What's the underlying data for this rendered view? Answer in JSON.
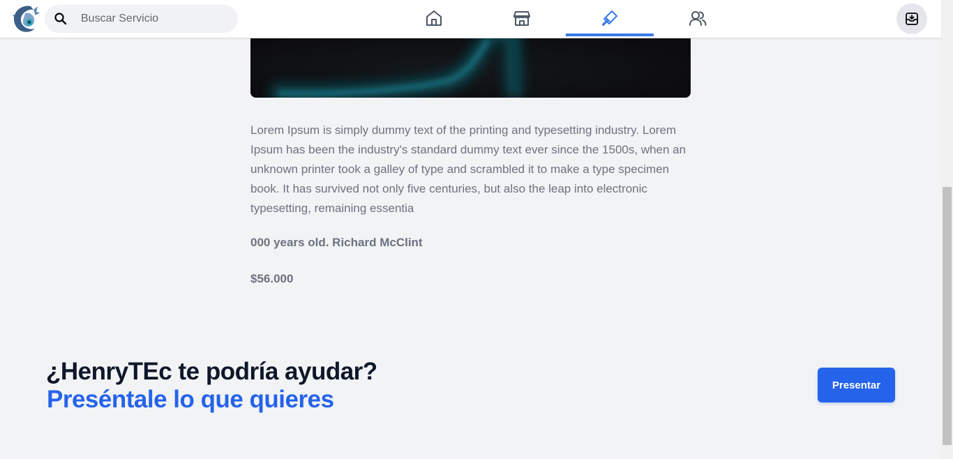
{
  "navbar": {
    "logo_icon": "dragon-logo-icon",
    "search": {
      "icon": "search-icon",
      "placeholder": "Buscar Servicio",
      "value": ""
    },
    "tabs": [
      {
        "icon": "home-icon",
        "active": false
      },
      {
        "icon": "store-icon",
        "active": false
      },
      {
        "icon": "brush-icon",
        "active": true
      },
      {
        "icon": "users-icon",
        "active": false
      }
    ],
    "right_button_icon": "archive-icon",
    "accent_color": "#3b7ae8"
  },
  "service": {
    "description": "Lorem Ipsum is simply dummy text of the printing and typesetting industry. Lorem Ipsum has been the industry's standard dummy text ever since the 1500s, when an unknown printer took a galley of type and scrambled it to make a type specimen book. It has survived not only five centuries, but also the leap into electronic typesetting, remaining essentia",
    "meta": "000 years old. Richard McClint",
    "price": "$56.000"
  },
  "cta": {
    "title": "¿HenryTEc te podría ayudar?",
    "subtitle": "Preséntale lo que quieres",
    "button_label": "Presentar",
    "primary_color": "#2563eb"
  }
}
